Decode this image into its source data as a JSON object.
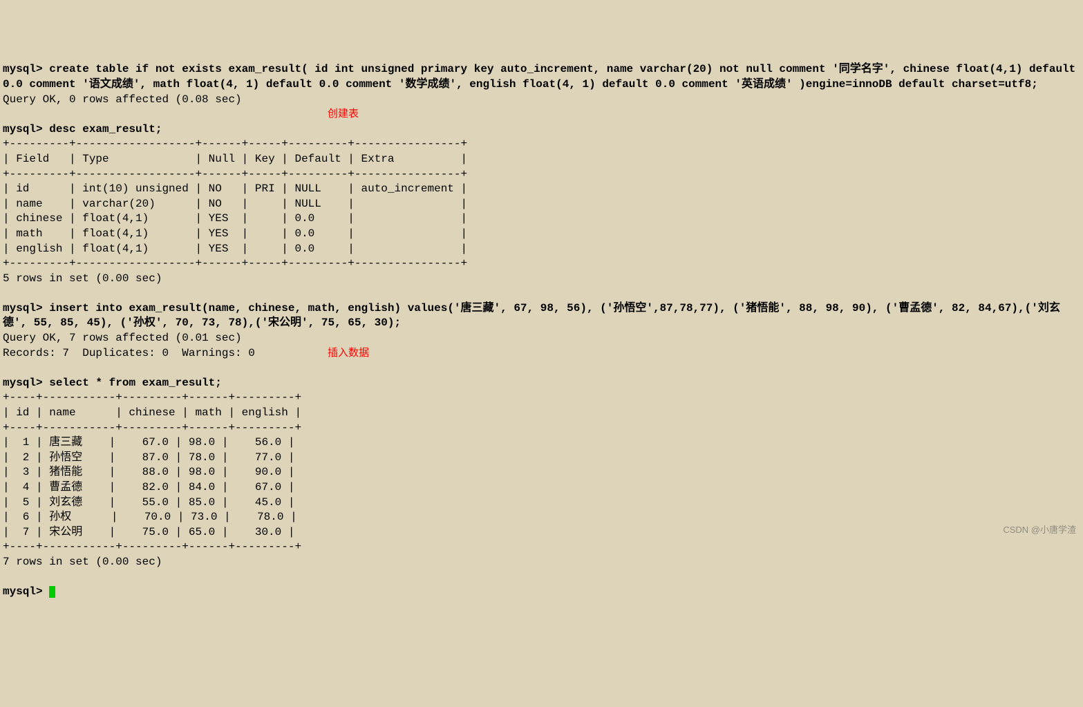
{
  "prompt": "mysql> ",
  "cmds": {
    "create": "create table if not exists exam_result( id int unsigned primary key auto_increment, name varchar(20) not null comment '同学名字', chinese float(4,1) default 0.0 comment '语文成绩', math float(4, 1) default 0.0 comment '数学成绩', english float(4, 1) default 0.0 comment '英语成绩' )engine=innoDB default charset=utf8;",
    "create_result": "Query OK, 0 rows affected (0.08 sec)",
    "desc": "desc exam_result;",
    "desc_table": {
      "sep": "+---------+------------------+------+-----+---------+----------------+",
      "head": "| Field   | Type             | Null | Key | Default | Extra          |",
      "rows": [
        "| id      | int(10) unsigned | NO   | PRI | NULL    | auto_increment |",
        "| name    | varchar(20)      | NO   |     | NULL    |                |",
        "| chinese | float(4,1)       | YES  |     | 0.0     |                |",
        "| math    | float(4,1)       | YES  |     | 0.0     |                |",
        "| english | float(4,1)       | YES  |     | 0.0     |                |"
      ],
      "footer": "5 rows in set (0.00 sec)"
    },
    "insert": "insert into exam_result(name, chinese, math, english) values('唐三藏', 67, 98, 56), ('孙悟空',87,78,77), ('猪悟能', 88, 98, 90), ('曹孟德', 82, 84,67),('刘玄德', 55, 85, 45), ('孙权', 70, 73, 78),('宋公明', 75, 65, 30);",
    "insert_result1": "Query OK, 7 rows affected (0.01 sec)",
    "insert_result2": "Records: 7  Duplicates: 0  Warnings: 0",
    "select": "select * from exam_result;",
    "select_table": {
      "sep": "+----+-----------+---------+------+---------+",
      "head": "| id | name      | chinese | math | english |",
      "rows": [
        "|  1 | 唐三藏    |    67.0 | 98.0 |    56.0 |",
        "|  2 | 孙悟空    |    87.0 | 78.0 |    77.0 |",
        "|  3 | 猪悟能    |    88.0 | 98.0 |    90.0 |",
        "|  4 | 曹孟德    |    82.0 | 84.0 |    67.0 |",
        "|  5 | 刘玄德    |    55.0 | 85.0 |    45.0 |",
        "|  6 | 孙权      |    70.0 | 73.0 |    78.0 |",
        "|  7 | 宋公明    |    75.0 | 65.0 |    30.0 |"
      ],
      "footer": "7 rows in set (0.00 sec)"
    }
  },
  "annotations": {
    "create": "创建表",
    "insert": "插入数据"
  },
  "watermark": "CSDN @小唐学渣"
}
